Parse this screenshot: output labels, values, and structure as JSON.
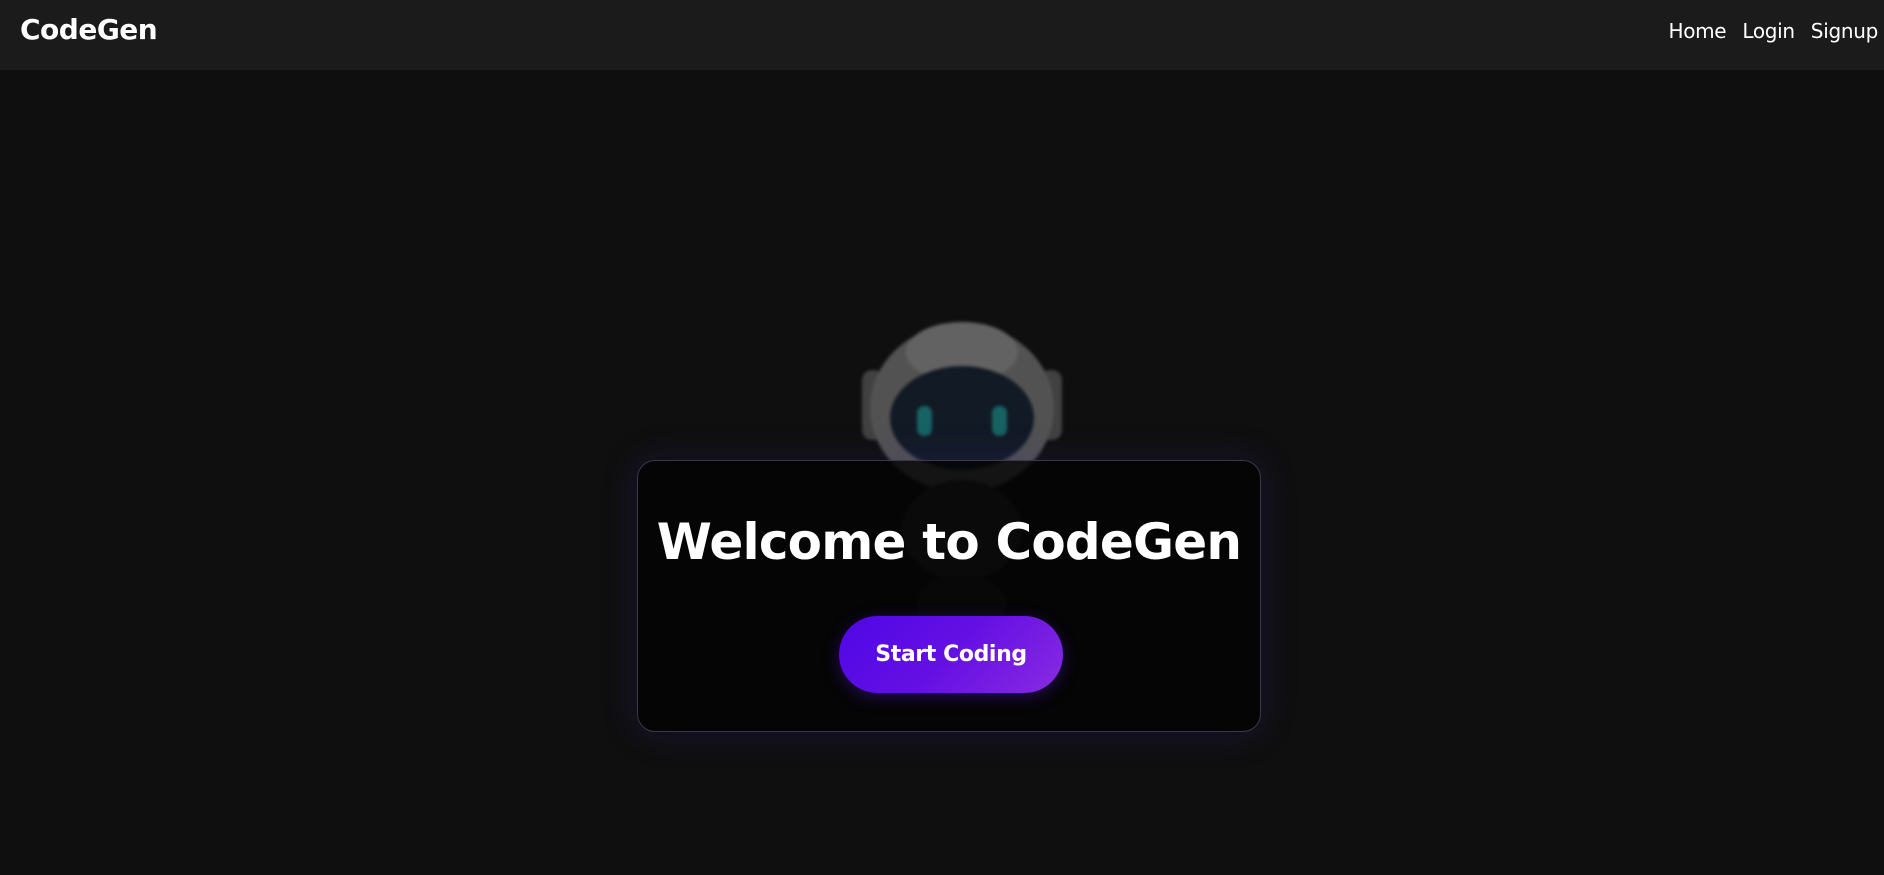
{
  "navbar": {
    "brand": "CodeGen",
    "links": [
      {
        "label": "Home"
      },
      {
        "label": "Login"
      },
      {
        "label": "Signup"
      }
    ]
  },
  "hero": {
    "title": "Welcome to CodeGen",
    "button_label": "Start Coding"
  },
  "colors": {
    "background": "#0f0f0f",
    "navbar": "#1b1b1b",
    "accent_start": "#4f07e6",
    "accent_end": "#8a2be2",
    "robot_eyes": "#1fa7a7"
  },
  "icons": {
    "mascot": "robot-mascot"
  }
}
